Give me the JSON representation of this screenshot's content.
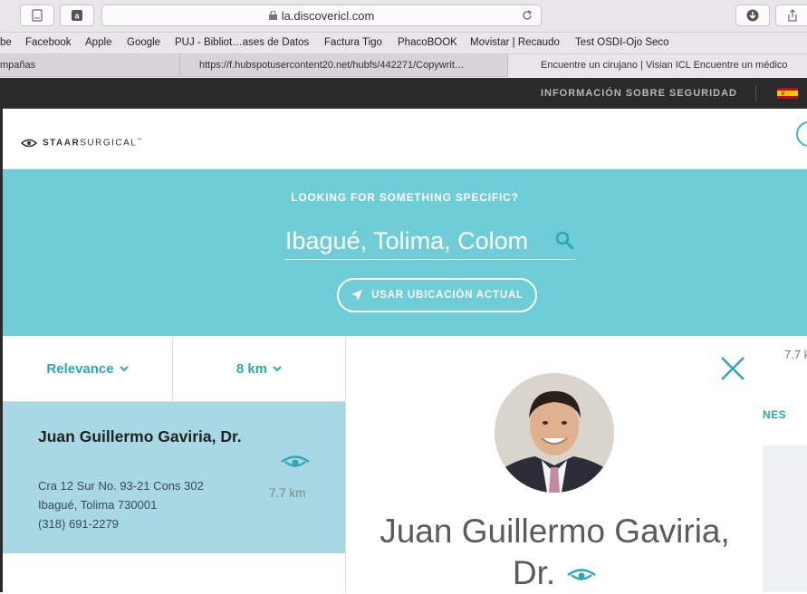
{
  "browser": {
    "url": "la.discovericl.com",
    "bookmarks": [
      "be",
      "Facebook",
      "Apple",
      "Google",
      "PUJ - Bibliot…ases de Datos",
      "Factura Tigo",
      "PhacoBOOK",
      "Movistar | Recaudo",
      "Test OSDI-Ojo Seco"
    ],
    "tabs": [
      "mpañas",
      "https://f.hubspotusercontent20.net/hubfs/442271/Copywrit…",
      "Encuentre un cirujano | Visian ICL Encuentre un médico"
    ]
  },
  "topbar": {
    "safety_label": "INFORMACIÓN SOBRE SEGURIDAD",
    "flag_icon": "spain-flag-icon"
  },
  "header": {
    "logo_bold": "STAAR",
    "logo_light": "SURGICAL",
    "logo_tm": "™"
  },
  "hero": {
    "title": "LOOKING FOR SOMETHING SPECIFIC?",
    "search_value": "Ibagué, Tolima, Colom",
    "location_button": "USAR UBICACIÓN ACTUAL"
  },
  "filters": {
    "sort": "Relevance",
    "radius": "8 km"
  },
  "result": {
    "name": "Juan Guillermo Gaviria, Dr.",
    "address_line1": "Cra 12 Sur No. 93-21 Cons 302",
    "address_line2": "Ibagué, Tolima 730001",
    "phone": "(318) 691-2279",
    "distance": "7.7 km"
  },
  "panel": {
    "name_line1": "Juan Guillermo Gaviria,",
    "name_line2": "Dr."
  },
  "right_strip": {
    "distance": "7.7 k",
    "label": "NES"
  },
  "colors": {
    "accent": "#2aa8b3",
    "hero_bg": "#6fcdd7",
    "result_bg": "#a8d8e4",
    "topbar_bg": "#2a2a2a"
  }
}
